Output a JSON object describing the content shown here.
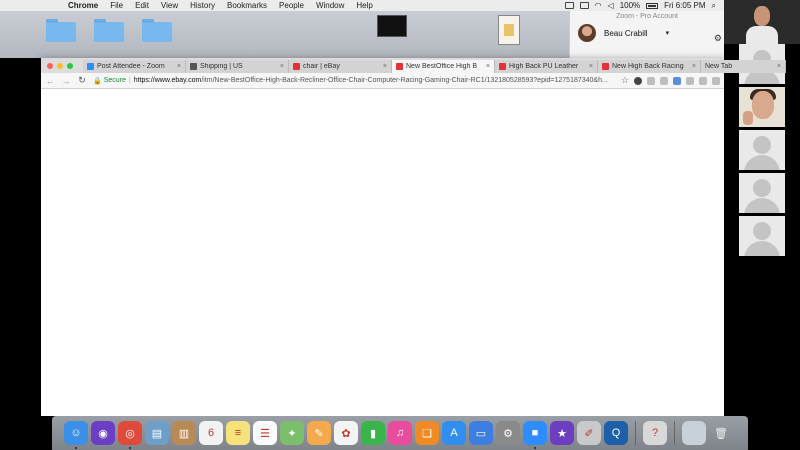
{
  "menubar": {
    "apple": "",
    "app_name": "Chrome",
    "items": [
      "File",
      "Edit",
      "View",
      "History",
      "Bookmarks",
      "People",
      "Window",
      "Help"
    ],
    "battery": "100%",
    "clock": "Fri 6:05 PM",
    "search_icon": "⌕"
  },
  "zoom": {
    "title": "Zoom - Pro Account",
    "user_name": "Beau Crabill",
    "caret": "▾",
    "gear": "⚙",
    "gear_letter": "S"
  },
  "chrome": {
    "tabs": [
      {
        "label": "Post Attendee - Zoom",
        "favicon_color": "#2d8cff",
        "active": false
      },
      {
        "label": "Shipping | US",
        "favicon_color": "#555555",
        "active": false
      },
      {
        "label": "chair | eBay",
        "favicon_color": "#e53238",
        "active": false
      },
      {
        "label": "New BestOffice High B",
        "favicon_color": "#e53238",
        "active": true
      },
      {
        "label": "High Back PU Leather",
        "favicon_color": "#e53238",
        "active": false
      },
      {
        "label": "New High Back Racing",
        "favicon_color": "#e53238",
        "active": false
      }
    ],
    "new_tab_label": "New Tab",
    "close_glyph": "×",
    "back": "←",
    "forward": "→",
    "reload": "↻",
    "lock": "🔒",
    "secure_label": "Secure",
    "separator": "|",
    "url_host": "https://www.ebay.com",
    "url_path": "/itm/New-BestOffice-High-Back-Recliner-Office-Chair-Computer-Racing-Gaming-Chair-RC1/132180528593?epid=1275187340&h...",
    "star": "☆"
  },
  "dock": {
    "apps": [
      {
        "name": "finder-icon",
        "color": "#3b8fe6",
        "glyph": "☺",
        "running": true
      },
      {
        "name": "siri-icon",
        "color": "#6a3fc4",
        "glyph": "◉",
        "running": false
      },
      {
        "name": "chrome-icon",
        "color": "#e04a3a",
        "glyph": "◎",
        "running": true
      },
      {
        "name": "preview-icon",
        "color": "#6e9fc9",
        "glyph": "▤",
        "running": false
      },
      {
        "name": "notes-folder-icon",
        "color": "#b88a55",
        "glyph": "▥",
        "running": false
      },
      {
        "name": "calendar-icon",
        "color": "#f2f2f2",
        "glyph": "6",
        "running": false
      },
      {
        "name": "notes-icon",
        "color": "#f6e27a",
        "glyph": "≡",
        "running": false
      },
      {
        "name": "reminders-icon",
        "color": "#fafafa",
        "glyph": "☰",
        "running": false
      },
      {
        "name": "maps-icon",
        "color": "#7cbf6a",
        "glyph": "✦",
        "running": false
      },
      {
        "name": "pages-icon",
        "color": "#f3a94c",
        "glyph": "✎",
        "running": false
      },
      {
        "name": "photos-icon",
        "color": "#f4f4f4",
        "glyph": "✿",
        "running": false
      },
      {
        "name": "numbers-icon",
        "color": "#3bb54a",
        "glyph": "▮",
        "running": false
      },
      {
        "name": "itunes-icon",
        "color": "#e94c9d",
        "glyph": "♫",
        "running": false
      },
      {
        "name": "ibooks-icon",
        "color": "#f08a24",
        "glyph": "❏",
        "running": false
      },
      {
        "name": "app-store-icon",
        "color": "#2f8ef0",
        "glyph": "A",
        "running": false
      },
      {
        "name": "keynote-icon",
        "color": "#3d7ee0",
        "glyph": "▭",
        "running": false
      },
      {
        "name": "system-preferences-icon",
        "color": "#8a8a8a",
        "glyph": "⚙",
        "running": false
      },
      {
        "name": "zoom-icon",
        "color": "#2d8cff",
        "glyph": "■",
        "running": true
      },
      {
        "name": "imovie-icon",
        "color": "#6c3fc0",
        "glyph": "★",
        "running": false
      },
      {
        "name": "script-editor-icon",
        "color": "#c9c9c9",
        "glyph": "✐",
        "running": false
      },
      {
        "name": "quicktime-icon",
        "color": "#1d5fa8",
        "glyph": "Q",
        "running": false
      },
      {
        "name": "help-icon",
        "color": "#d8d8d8",
        "glyph": "?",
        "running": false
      }
    ],
    "trash_glyph": "🗑"
  }
}
